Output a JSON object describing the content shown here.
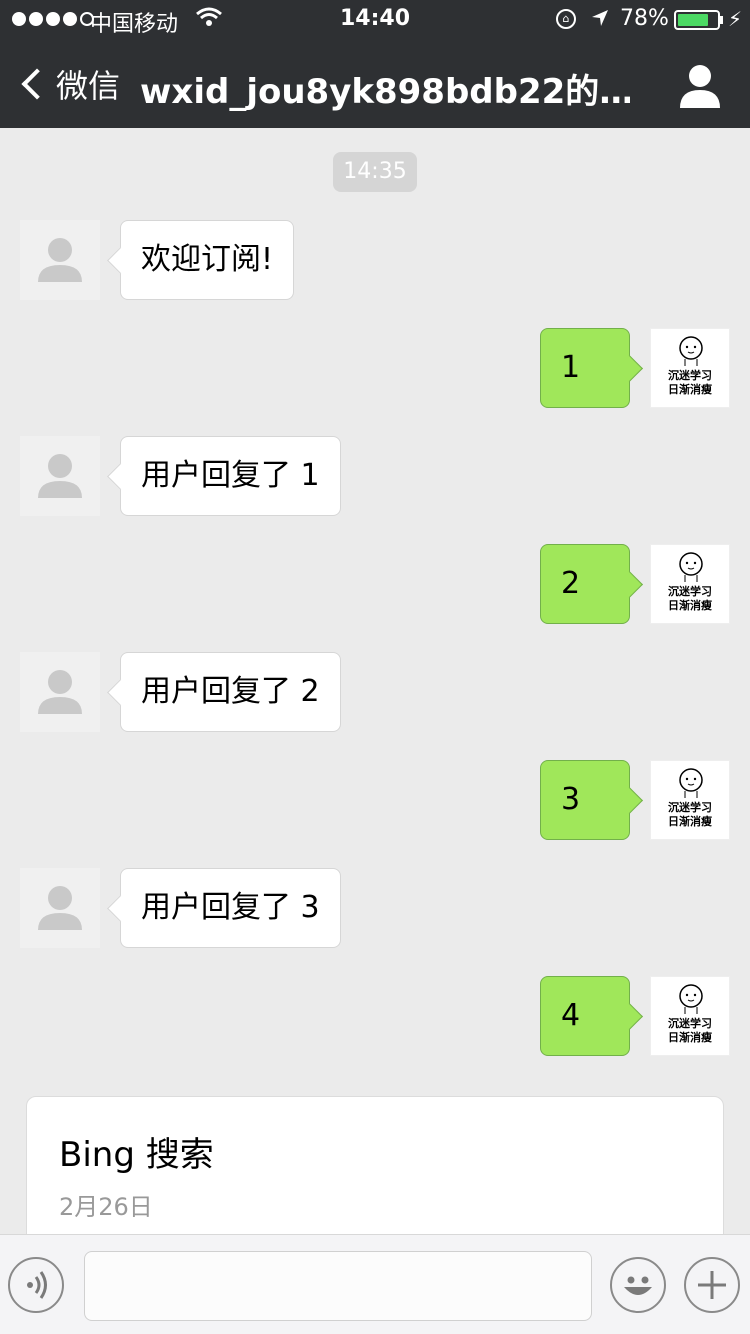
{
  "status_bar": {
    "carrier": "中国移动",
    "time": "14:40",
    "battery_percent": "78%",
    "battery_level": 0.78,
    "signal_bars_filled": 4
  },
  "nav": {
    "back_label": "微信",
    "title": "wxid_jou8yk898bdb22的…"
  },
  "chat": {
    "timestamp": "14:35",
    "incoming": [
      {
        "text": "欢迎订阅!"
      },
      {
        "text": "用户回复了 1"
      },
      {
        "text": "用户回复了 2"
      },
      {
        "text": "用户回复了 3"
      }
    ],
    "outgoing": [
      {
        "text": "1"
      },
      {
        "text": "2"
      },
      {
        "text": "3"
      },
      {
        "text": "4"
      }
    ],
    "sticker_avatar": {
      "line1": "沉迷学习",
      "line2": "日渐消瘦"
    }
  },
  "card": {
    "title": "Bing 搜索",
    "date": "2月26日"
  },
  "input_bar": {
    "placeholder": ""
  },
  "colors": {
    "nav_background": "#2e3033",
    "chat_background": "#ebebeb",
    "outgoing_bubble": "#a0e75a",
    "incoming_bubble": "#ffffff",
    "battery_fill": "#4cd964"
  },
  "icons": [
    "wifi-icon",
    "lock-rotation-icon",
    "location-arrow-icon",
    "battery-icon",
    "charging-bolt-icon",
    "back-chevron-icon",
    "profile-icon",
    "default-avatar-icon",
    "voice-icon",
    "emoji-icon",
    "plus-icon"
  ]
}
